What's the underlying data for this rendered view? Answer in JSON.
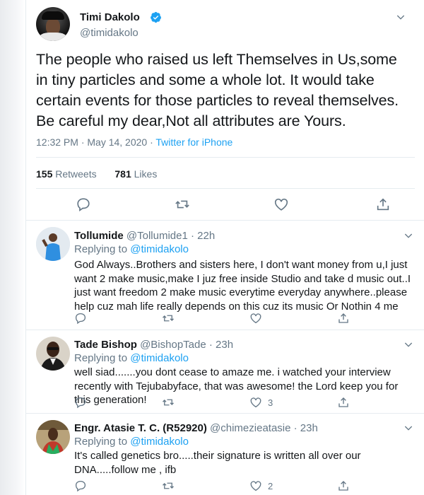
{
  "tweet": {
    "name": "Timi Dakolo",
    "handle": "@timidakolo",
    "text": "The people who raised us left Themselves in Us,some in tiny particles and some a whole lot. It would take certain events for those particles to reveal themselves. Be careful my dear,Not all attributes are Yours.",
    "time": "12:32 PM · May 14, 2020 · ",
    "source": "Twitter for iPhone",
    "retweets_count": "155",
    "retweets_label": "Retweets",
    "likes_count": "781",
    "likes_label": "Likes"
  },
  "replies": [
    {
      "name": "Tollumide",
      "handle": "@Tollumide1 · 22h",
      "replying_prefix": "Replying to ",
      "replying_to": "@timidakolo",
      "text": "God Always..Brothers and sisters here, I don't want money from u,I just want 2 make music,make I juz free inside Studio and take d music out..I just want freedom 2 make music everytime everyday anywhere..please help cuz mah life really depends on this cuz its music Or Nothin 4 me",
      "likes": ""
    },
    {
      "name": "Tade Bishop",
      "handle": "@BishopTade · 23h",
      "replying_prefix": "Replying to ",
      "replying_to": "@timidakolo",
      "text": "well siad.......you dont cease to amaze me. i watched your interview recently with Tejubabyface, that was awesome! the Lord keep you for this generation!",
      "likes": "3"
    },
    {
      "name": "Engr. Atasie T. C. (R52920)",
      "handle": "@chimezieatasie · 23h",
      "replying_prefix": "Replying to ",
      "replying_to": "@timidakolo",
      "text": "It's called genetics bro.....their signature is written all over our DNA.....follow me , ifb",
      "likes": "2"
    }
  ],
  "colors": {
    "accent": "#1da1f2",
    "muted": "#657786",
    "text": "#14171a",
    "border": "#e6ecf0"
  }
}
